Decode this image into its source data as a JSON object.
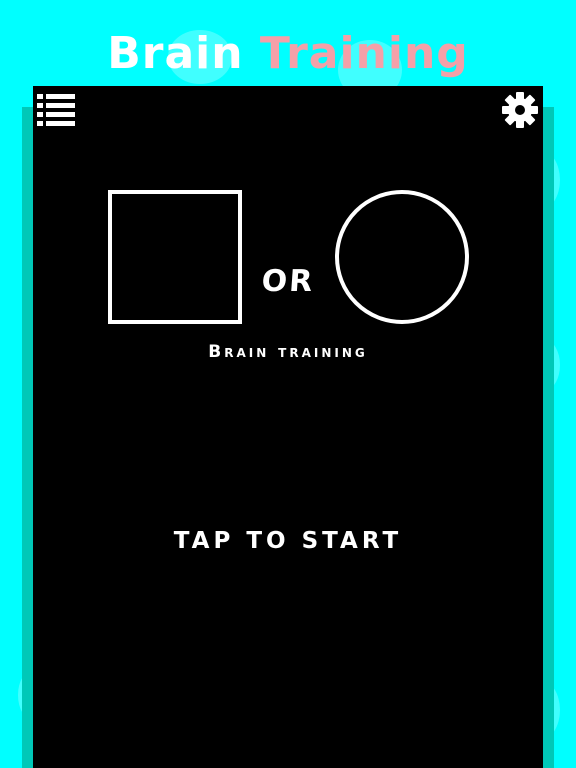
{
  "header": {
    "title_part1": "Brain",
    "title_part2": "Training"
  },
  "toolbar": {
    "menu_icon": "list-icon",
    "settings_icon": "gear-icon"
  },
  "game": {
    "shape_left": "square",
    "connector": "OR",
    "shape_right": "circle",
    "subtitle": "Brain training",
    "start_prompt": "TAP TO START"
  },
  "colors": {
    "background": "#00ffff",
    "screen": "#000000",
    "title_accent": "#f4a0a8",
    "foreground": "#ffffff",
    "shadow": "#00c8b8"
  }
}
